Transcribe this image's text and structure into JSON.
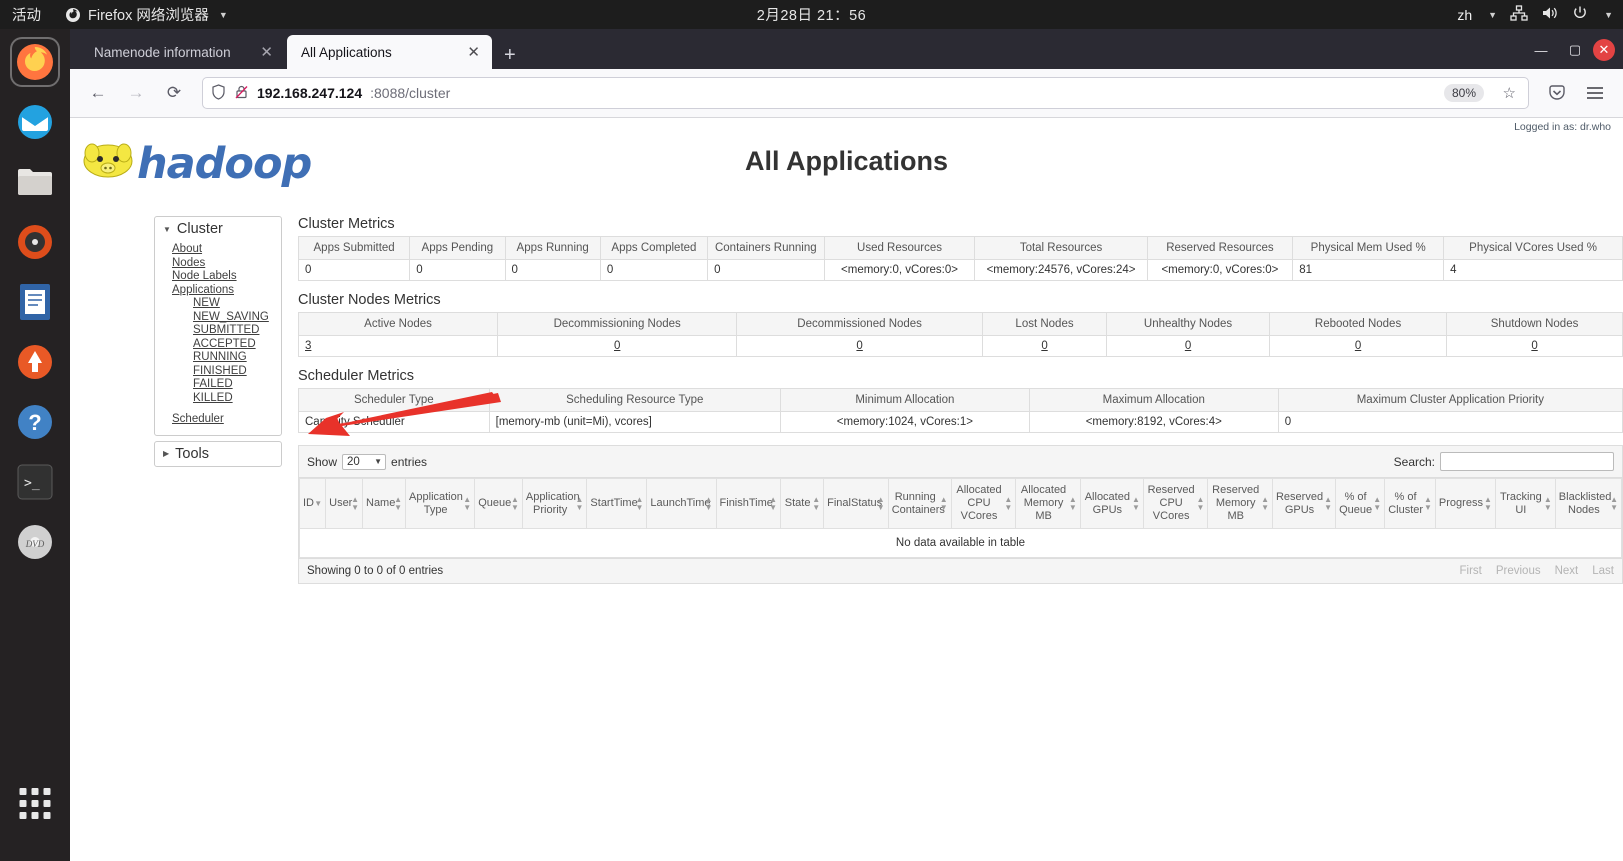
{
  "topbar": {
    "activities": "活动",
    "app_name": "Firefox 网络浏览器",
    "datetime": "2月28日 21：56",
    "input_source": "zh",
    "icons": [
      "network-icon",
      "volume-icon",
      "power-icon",
      "chevron-down-icon"
    ]
  },
  "browser": {
    "tabs": [
      {
        "title": "Namenode information",
        "active": false
      },
      {
        "title": "All Applications",
        "active": true
      }
    ],
    "new_tab_label": "+",
    "window_controls": {
      "minimize": "—",
      "maximize": "▢",
      "close": "✕"
    },
    "nav": {
      "back": "←",
      "forward": "→",
      "reload": "⟳"
    },
    "url": {
      "host": "192.168.247.124",
      "path": ":8088/cluster",
      "zoom": "80%"
    },
    "toolbar_right": {
      "pocket": "pocket-icon",
      "menu": "menu-icon"
    }
  },
  "page": {
    "logged_in": "Logged in as: dr.who",
    "logo_text": "hadoop",
    "title": "All Applications"
  },
  "sidebar": {
    "cluster": {
      "label": "Cluster",
      "links": [
        "About",
        "Nodes",
        "Node Labels",
        "Applications"
      ],
      "app_states": [
        "NEW",
        "NEW_SAVING",
        "SUBMITTED",
        "ACCEPTED",
        "RUNNING",
        "FINISHED",
        "FAILED",
        "KILLED"
      ],
      "scheduler": "Scheduler"
    },
    "tools": {
      "label": "Tools"
    }
  },
  "cluster_metrics": {
    "title": "Cluster Metrics",
    "headers": [
      "Apps Submitted",
      "Apps Pending",
      "Apps Running",
      "Apps Completed",
      "Containers Running",
      "Used Resources",
      "Total Resources",
      "Reserved Resources",
      "Physical Mem Used %",
      "Physical VCores Used %"
    ],
    "values": [
      "0",
      "0",
      "0",
      "0",
      "0",
      "<memory:0, vCores:0>",
      "<memory:24576, vCores:24>",
      "<memory:0, vCores:0>",
      "81",
      "4"
    ]
  },
  "cluster_nodes_metrics": {
    "title": "Cluster Nodes Metrics",
    "headers": [
      "Active Nodes",
      "Decommissioning Nodes",
      "Decommissioned Nodes",
      "Lost Nodes",
      "Unhealthy Nodes",
      "Rebooted Nodes",
      "Shutdown Nodes"
    ],
    "values": [
      "3",
      "0",
      "0",
      "0",
      "0",
      "0",
      "0"
    ]
  },
  "scheduler_metrics": {
    "title": "Scheduler Metrics",
    "headers": [
      "Scheduler Type",
      "Scheduling Resource Type",
      "Minimum Allocation",
      "Maximum Allocation",
      "Maximum Cluster Application Priority"
    ],
    "values": [
      "Capacity Scheduler",
      "[memory-mb (unit=Mi), vcores]",
      "<memory:1024, vCores:1>",
      "<memory:8192, vCores:4>",
      "0"
    ]
  },
  "apps_table": {
    "show_label": "Show",
    "entries_label": "entries",
    "page_size": "20",
    "search_label": "Search:",
    "search_value": "",
    "columns": [
      "ID",
      "User",
      "Name",
      "Application Type",
      "Queue",
      "Application Priority",
      "StartTime",
      "LaunchTime",
      "FinishTime",
      "State",
      "FinalStatus",
      "Running Containers",
      "Allocated CPU VCores",
      "Allocated Memory MB",
      "Allocated GPUs",
      "Reserved CPU VCores",
      "Reserved Memory MB",
      "Reserved GPUs",
      "% of Queue",
      "% of Cluster",
      "Progress",
      "Tracking UI",
      "Blacklisted Nodes"
    ],
    "empty_message": "No data available in table",
    "showing_text": "Showing 0 to 0 of 0 entries",
    "pager": [
      "First",
      "Previous",
      "Next",
      "Last"
    ]
  },
  "annotation": {
    "type": "red-arrow",
    "points_at": "Active Nodes value 3"
  },
  "colors": {
    "accent": "#3f6fb5",
    "arrow": "#e8322a",
    "chrome_dark": "#2b2a33"
  }
}
